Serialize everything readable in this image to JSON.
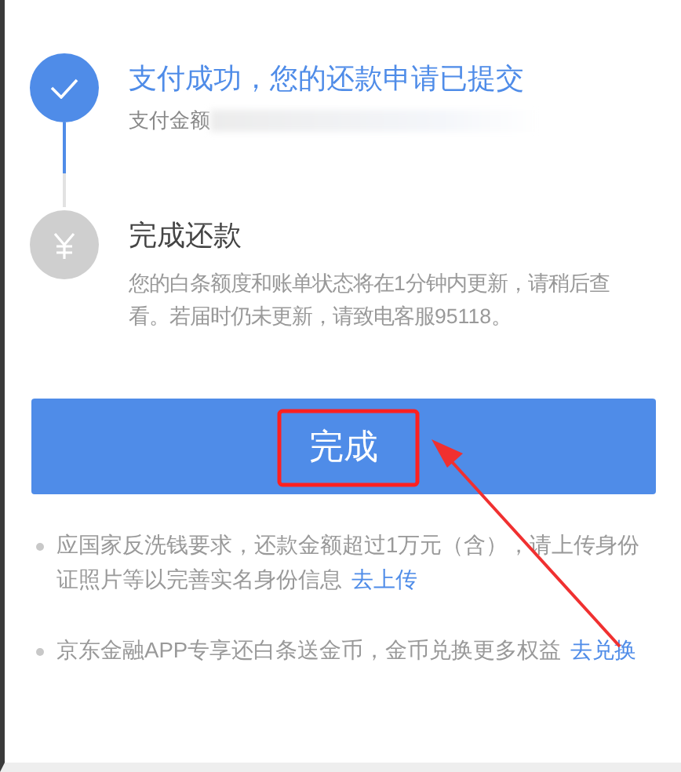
{
  "steps": [
    {
      "done": true,
      "title": "支付成功，您的还款申请已提交",
      "subtitle": "支付金额"
    },
    {
      "done": false,
      "title": "完成还款",
      "description": "您的白条额度和账单状态将在1分钟内更新，请稍后查看。若届时仍未更新，请致电客服95118。"
    }
  ],
  "button": {
    "label": "完成"
  },
  "notes": [
    {
      "text": "应国家反洗钱要求，还款金额超过1万元（含），请上传身份证照片等以完善实名身份信息",
      "link": "去上传"
    },
    {
      "text": "京东金融APP专享还白条送金币，金币兑换更多权益",
      "link": "去兑换"
    }
  ]
}
